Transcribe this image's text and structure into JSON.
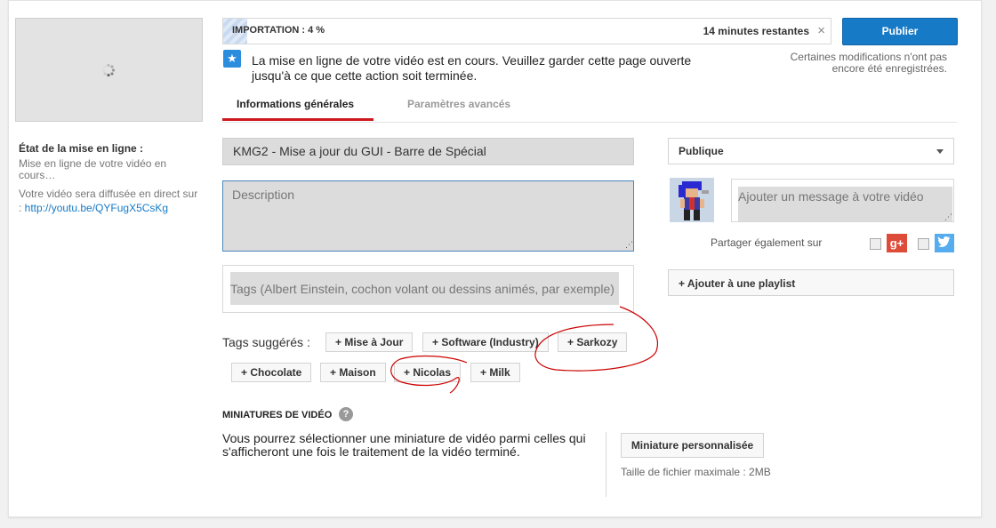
{
  "left": {
    "status_title": "État de la mise en ligne :",
    "status_text": "Mise en ligne de votre vidéo en cours…",
    "live_text": "Votre vidéo sera diffusée en direct sur : ",
    "live_link": "http://youtu.be/QYFugX5CsKg"
  },
  "progress": {
    "label": "IMPORTATION : 4 %",
    "percent": 4,
    "remaining": "14 minutes restantes",
    "close_icon": "×"
  },
  "publish": {
    "label": "Publier",
    "save_note": "Certaines modifications n'ont pas encore été enregistrées."
  },
  "info": {
    "icon": "★",
    "text": "La mise en ligne de votre vidéo est en cours. Veuillez garder cette page ouverte jusqu'à ce que cette action soit terminée."
  },
  "tabs": [
    {
      "label": "Informations générales",
      "active": true
    },
    {
      "label": "Paramètres avancés",
      "active": false
    }
  ],
  "form": {
    "title_value": "KMG2 - Mise a jour du GUI - Barre de Spécial",
    "description_placeholder": "Description",
    "tags_placeholder": "Tags (Albert Einstein, cochon volant ou dessins animés, par exemple)",
    "suggested_label": "Tags suggérés :",
    "suggested_tags": [
      "+ Mise à Jour",
      "+ Software (Industry)",
      "+ Sarkozy",
      "+ Chocolate",
      "+ Maison",
      "+ Nicolas",
      "+ Milk"
    ]
  },
  "thumbnails": {
    "title": "MINIATURES DE VIDÉO",
    "help_icon": "?",
    "text": "Vous pourrez sélectionner une miniature de vidéo parmi celles qui s'afficheront une fois le traitement de la vidéo terminé.",
    "custom_button": "Miniature personnalisée",
    "size_note": "Taille de fichier maximale : 2MB"
  },
  "right": {
    "privacy_value": "Publique",
    "share_placeholder": "Ajouter un message à votre vidéo",
    "share_also": "Partager également sur",
    "gplus_label": "g+",
    "playlist_button": "+ Ajouter à une playlist"
  },
  "colors": {
    "accent": "#167ac6",
    "tab_underline": "#cc181e",
    "annotation": "#cc0000"
  }
}
